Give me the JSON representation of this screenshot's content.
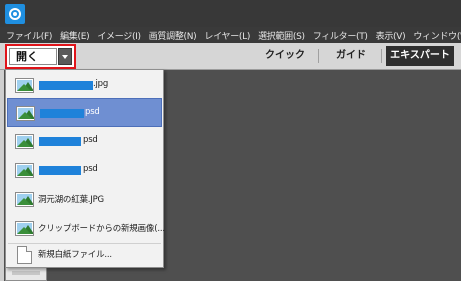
{
  "menu": [
    "ファイル(F)",
    "編集(E)",
    "イメージ(I)",
    "画質調整(N)",
    "レイヤー(L)",
    "選択範囲(S)",
    "フィルター(T)",
    "表示(V)",
    "ウィンドウ(W)"
  ],
  "open_button": {
    "label": "開く"
  },
  "modes": {
    "quick": "クイック",
    "guided": "ガイド",
    "expert": "エキスパート"
  },
  "recent_files": [
    {
      "label": ".jpg",
      "icon": "image-file-icon",
      "redacted": true,
      "selected": false
    },
    {
      "label": "psd",
      "icon": "image-file-icon",
      "redacted": true,
      "selected": true
    },
    {
      "label": "psd",
      "icon": "image-file-icon",
      "redacted": true,
      "selected": false
    },
    {
      "label": "psd",
      "icon": "image-file-icon",
      "redacted": true,
      "selected": false
    },
    {
      "label": "洞元湖の紅葉.JPG",
      "icon": "image-file-icon",
      "redacted": false,
      "selected": false
    },
    {
      "label": "クリップボードからの新規画像(...",
      "icon": "image-file-icon",
      "redacted": false,
      "selected": false
    },
    {
      "label": "新規白紙ファイル...",
      "icon": "blank-document-icon",
      "redacted": false,
      "selected": false
    }
  ],
  "colors": {
    "selected_row": "#6f8fd2",
    "redaction": "#1f82da",
    "highlight_border": "#e0141a"
  }
}
